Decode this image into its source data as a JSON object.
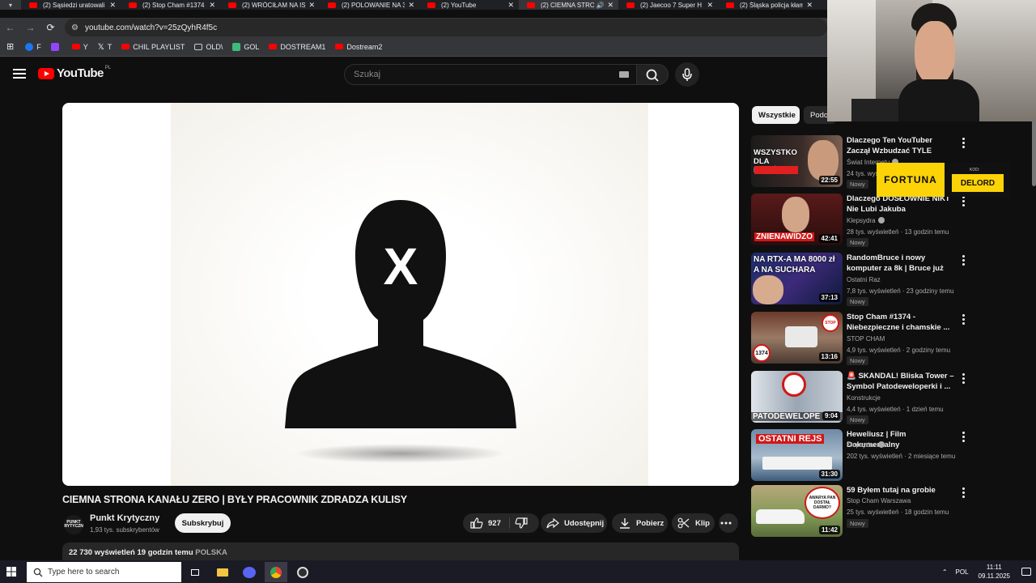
{
  "browser": {
    "tabs": [
      {
        "title": "(2) Sąsiedzi uratowali",
        "active": false
      },
      {
        "title": "(2) Stop Cham #1374",
        "active": false
      },
      {
        "title": "(2) WRÓCIŁAM NA IS",
        "active": false
      },
      {
        "title": "(2) POLOWANIE NA 3",
        "active": false
      },
      {
        "title": "(2) YouTube",
        "active": false
      },
      {
        "title": "(2) CIEMNA STRO",
        "active": true
      },
      {
        "title": "(2) Jaecoo 7 Super H",
        "active": false
      },
      {
        "title": "(2) Śląska policja kłam",
        "active": false
      }
    ],
    "url": "youtube.com/watch?v=25zQyhR4f5c",
    "bookmarks": [
      {
        "label": "F",
        "icon": "facebook-icon",
        "color": "#1877f2"
      },
      {
        "label": "",
        "icon": "twitch-icon",
        "color": "#9146ff"
      },
      {
        "label": "Y",
        "icon": "youtube-icon",
        "color": "#ff0000"
      },
      {
        "label": "T",
        "icon": "x-icon",
        "color": "#000000"
      },
      {
        "label": "CHIL PLAYLIST",
        "icon": "youtube-icon",
        "color": "#ff0000"
      },
      {
        "label": "OLD\\",
        "icon": "folder-icon",
        "color": ""
      },
      {
        "label": "GOL",
        "icon": "gol-icon",
        "color": "#3dbb7a"
      },
      {
        "label": "DOSTREAM1",
        "icon": "youtube-icon",
        "color": "#ff0000"
      },
      {
        "label": "Dostream2",
        "icon": "youtube-icon",
        "color": "#ff0000"
      }
    ]
  },
  "youtube": {
    "logo_text": "YouTube",
    "country_code": "PL",
    "search_placeholder": "Szukaj"
  },
  "video": {
    "title": "CIEMNA STRONA KANAŁU ZERO | BYŁY PRACOWNIK ZDRADZA KULISY",
    "channel": "Punkt Krytyczny",
    "subscribers": "1,93 tys. subskrybentów",
    "avatar_text": "PUNKT KRYTYCZNY",
    "subscribe_label": "Subskrybuj",
    "likes": "927",
    "share_label": "Udostępnij",
    "download_label": "Pobierz",
    "clip_label": "Klip",
    "views_line": "22 730 wyświetleń  19 godzin temu",
    "location": "POLSKA"
  },
  "sidebar": {
    "chips": [
      {
        "label": "Wszystkie",
        "active": true
      },
      {
        "label": "Podo",
        "active": false
      }
    ],
    "videos": [
      {
        "title": "Dlaczego Ten YouTuber Zaczął Wzbudzać TYLE Skrajnych ...",
        "channel": "Świat Internetu",
        "views": "24 tys. wyświetleń",
        "badge": "Nowy",
        "duration": "22:55",
        "thumb_text": "WSZYSTKO DLA KLIKÓW",
        "verified": true
      },
      {
        "title": "Dlaczego DOSŁOWNIE NIKT Nie Lubi Jakuba Rzeźniczaka?",
        "channel": "Klepsydra",
        "views": "28 tys. wyświetleń · 13 godzin temu",
        "badge": "Nowy",
        "duration": "42:41",
        "thumb_text": "ZNIENAWIDZO",
        "verified": true
      },
      {
        "title": "RandomBruce i nowy komputer za 8k | Bruce już nie chce ...",
        "channel": "Ostatni Raz",
        "views": "7,8 tys. wyświetleń · 23 godziny temu",
        "badge": "Nowy",
        "duration": "37:13",
        "thumb_text": "NA RTX-A MA 8000 zł A NA SUCHARA",
        "verified": false
      },
      {
        "title": "Stop Cham #1374 - Niebezpieczne i chamskie ...",
        "channel": "STOP CHAM",
        "views": "4,9 tys. wyświetleń · 2 godziny temu",
        "badge": "Nowy",
        "duration": "13:16",
        "thumb_text": "1374",
        "verified": false
      },
      {
        "title": "🚨 SKANDAL! Bliska Tower – Symbol Patodeweloperki i ...",
        "channel": "Konstrukcje",
        "views": "4,4 tys. wyświetleń · 1 dzień temu",
        "badge": "Nowy",
        "duration": "9:04",
        "thumb_text": "PATODEWELOPE",
        "verified": false
      },
      {
        "title": "Heweliusz | Film Dokumentalny",
        "channel": "Klepsydra",
        "views": "202 tys. wyświetleń · 2 miesiące temu",
        "badge": "",
        "duration": "31:30",
        "thumb_text": "OSTATNI REJS",
        "verified": true
      },
      {
        "title": "59 Byłem tutaj na grobie",
        "channel": "Stop Cham Warszawa",
        "views": "25 tys. wyświetleń · 18 godzin temu",
        "badge": "Nowy",
        "duration": "11:42",
        "thumb_text": "AWARYA PAN DOSTAŁ DARMO?",
        "verified": false
      }
    ]
  },
  "overlay": {
    "sponsor": "FORTUNA",
    "code_label": "KOD:",
    "code": "DELORD"
  },
  "taskbar": {
    "search_placeholder": "Type here to search",
    "language": "POL",
    "time": "11:11",
    "date": "09.11.2025"
  },
  "colors": {
    "background": "#0f0f0f",
    "accent": "#ff0000",
    "chip_active": "#f1f1f1",
    "sponsor_yellow": "#fcd307"
  }
}
